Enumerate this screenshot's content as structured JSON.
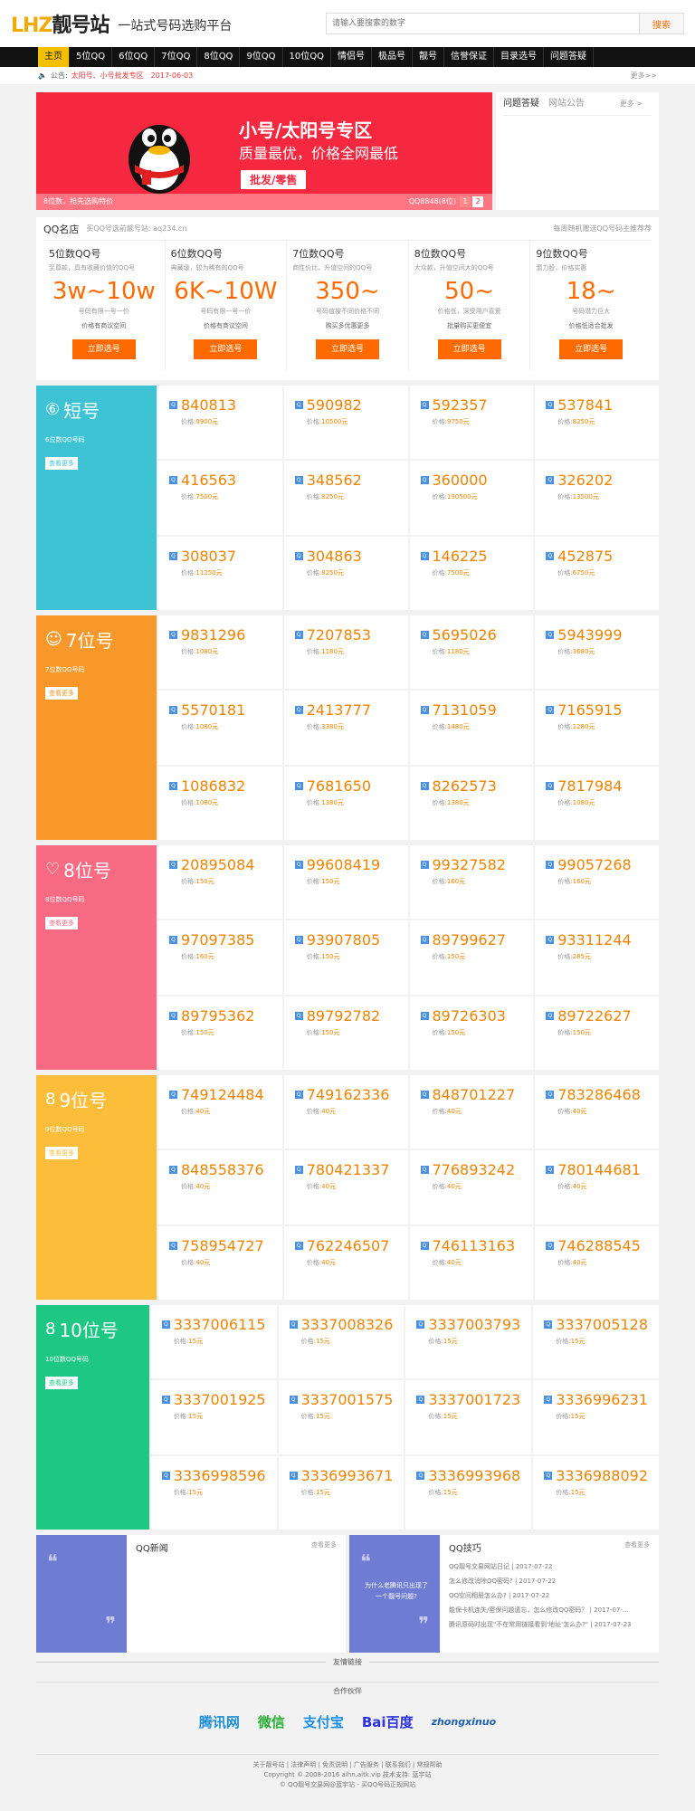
{
  "header": {
    "logo_lhz": "LHZ",
    "logo_cn": "靓号站",
    "slogan": "一站式号码选购平台",
    "search_placeholder": "请输入要搜索的数字",
    "search_button": "搜索"
  },
  "nav": [
    "主页",
    "5位QQ",
    "6位QQ",
    "7位QQ",
    "8位QQ",
    "9位QQ",
    "10位QQ",
    "情侣号",
    "极品号",
    "靓号",
    "信誉保证",
    "目录选号",
    "问题答疑"
  ],
  "notice": {
    "label": "公告:",
    "text": "太阳号、小号批发专区",
    "date": "2017-06-03",
    "more": "更多>>"
  },
  "banner": {
    "title": "小号/太阳号专区",
    "sub": "质量最优，价格全网最低",
    "button": "批发/零售",
    "strip": "8位数，抢先选购特价",
    "counter": "QQ8848(8位)",
    "dots": [
      "1",
      "2"
    ]
  },
  "sidebox": {
    "tab1": "问题答疑",
    "tab2": "网站公告",
    "more": "更多 >"
  },
  "qqshop": {
    "title": "QQ名店",
    "sub": "买QQ号选前靓号站: aq234.cn",
    "right": "每周随机赠送QQ号码主推荐荐"
  },
  "cats": [
    {
      "name": "5位数QQ号",
      "desc": "至尊款，具有收藏价值的QQ号",
      "range": "3w~10w",
      "d2": "号码有限一号一价",
      "d3": "价格有商议空间",
      "btn": "立即选号"
    },
    {
      "name": "6位数QQ号",
      "desc": "典藏级，较为稀有的QQ号",
      "range": "6K~10W",
      "d2": "号码有限一号一价",
      "d3": "价格有商议空间",
      "btn": "立即选号"
    },
    {
      "name": "7位数QQ号",
      "desc": "商性价比，升值空间的QQ号",
      "range": "350~",
      "d2": "号码值按不同价格不同",
      "d3": "购买多优惠更多",
      "btn": "立即选号"
    },
    {
      "name": "8位数QQ号",
      "desc": "大众款，升值空间大的QQ号",
      "range": "50~",
      "d2": "价格低，深受用户喜爱",
      "d3": "批量购买更便宜",
      "btn": "立即选号"
    },
    {
      "name": "9位数QQ号",
      "desc": "潜力股，价格实惠",
      "range": "18~",
      "d2": "号码潜力巨大",
      "d3": "价格低适合批发",
      "btn": "立即选号"
    }
  ],
  "sections": [
    {
      "title": "短号",
      "icon": "⑥",
      "color": "#3ec3d5",
      "desc": "6位数QQ号码",
      "more": "查看更多",
      "items": [
        {
          "num": "840813",
          "price": "9900元"
        },
        {
          "num": "590982",
          "price": "10500元"
        },
        {
          "num": "592357",
          "price": "9750元"
        },
        {
          "num": "537841",
          "price": "8250元"
        },
        {
          "num": "416563",
          "price": "7500元"
        },
        {
          "num": "348562",
          "price": "8250元"
        },
        {
          "num": "360000",
          "price": "190500元"
        },
        {
          "num": "326202",
          "price": "13500元"
        },
        {
          "num": "308037",
          "price": "11250元"
        },
        {
          "num": "304863",
          "price": "8250元"
        },
        {
          "num": "146225",
          "price": "7500元"
        },
        {
          "num": "452875",
          "price": "6750元"
        }
      ]
    },
    {
      "title": "7位号",
      "icon": "☺",
      "color": "#f9982a",
      "desc": "7位数QQ号码",
      "more": "查看更多",
      "items": [
        {
          "num": "9831296",
          "price": "1080元"
        },
        {
          "num": "7207853",
          "price": "1180元"
        },
        {
          "num": "5695026",
          "price": "1180元"
        },
        {
          "num": "5943999",
          "price": "3680元"
        },
        {
          "num": "5570181",
          "price": "1080元"
        },
        {
          "num": "2413777",
          "price": "3380元"
        },
        {
          "num": "7131059",
          "price": "1480元"
        },
        {
          "num": "7165915",
          "price": "1280元"
        },
        {
          "num": "1086832",
          "price": "1080元"
        },
        {
          "num": "7681650",
          "price": "1380元"
        },
        {
          "num": "8262573",
          "price": "1380元"
        },
        {
          "num": "7817984",
          "price": "1080元"
        }
      ]
    },
    {
      "title": "8位号",
      "icon": "♡",
      "color": "#f86b83",
      "desc": "8位数QQ号码",
      "more": "查看更多",
      "items": [
        {
          "num": "20895084",
          "price": "150元"
        },
        {
          "num": "99608419",
          "price": "150元"
        },
        {
          "num": "99327582",
          "price": "160元"
        },
        {
          "num": "99057268",
          "price": "160元"
        },
        {
          "num": "97097385",
          "price": "160元"
        },
        {
          "num": "93907805",
          "price": "150元"
        },
        {
          "num": "89799627",
          "price": "150元"
        },
        {
          "num": "93311244",
          "price": "285元"
        },
        {
          "num": "89795362",
          "price": "150元"
        },
        {
          "num": "89792782",
          "price": "150元"
        },
        {
          "num": "89726303",
          "price": "150元"
        },
        {
          "num": "89722627",
          "price": "150元"
        }
      ]
    },
    {
      "title": "9位号",
      "icon": "8",
      "color": "#fcbd3b",
      "desc": "9位数QQ号码",
      "more": "查看更多",
      "items": [
        {
          "num": "749124484",
          "price": "40元"
        },
        {
          "num": "749162336",
          "price": "40元"
        },
        {
          "num": "848701227",
          "price": "40元"
        },
        {
          "num": "783286468",
          "price": "40元"
        },
        {
          "num": "848558376",
          "price": "40元"
        },
        {
          "num": "780421337",
          "price": "40元"
        },
        {
          "num": "776893242",
          "price": "40元"
        },
        {
          "num": "780144681",
          "price": "40元"
        },
        {
          "num": "758954727",
          "price": "40元"
        },
        {
          "num": "762246507",
          "price": "40元"
        },
        {
          "num": "746113163",
          "price": "40元"
        },
        {
          "num": "746288545",
          "price": "40元"
        }
      ]
    },
    {
      "title": "10位号",
      "icon": "8",
      "color": "#1ec884",
      "desc": "10位数QQ号码",
      "more": "查看更多",
      "items": [
        {
          "num": "3337006115",
          "price": "15元"
        },
        {
          "num": "3337008326",
          "price": "15元"
        },
        {
          "num": "3337003793",
          "price": "15元"
        },
        {
          "num": "3337005128",
          "price": "15元"
        },
        {
          "num": "3337001925",
          "price": "15元"
        },
        {
          "num": "3337001575",
          "price": "15元"
        },
        {
          "num": "3337001723",
          "price": "15元"
        },
        {
          "num": "3336996231",
          "price": "15元"
        },
        {
          "num": "3336998596",
          "price": "15元"
        },
        {
          "num": "3336993671",
          "price": "15元"
        },
        {
          "num": "3336993968",
          "price": "15元"
        },
        {
          "num": "3336988092",
          "price": "15元"
        }
      ]
    }
  ],
  "price_label": "价格:",
  "news": {
    "title": "QQ新闻",
    "more": "查看更多"
  },
  "tips": {
    "title": "QQ技巧",
    "more": "查看更多",
    "deco": "为什么老腾讯只出现了一个靓号问题?",
    "items": [
      "QQ靓号交易网站日记 | 2017-07-22",
      "怎么修改消除QQ密码? | 2017-07-22",
      "QQ空间相册怎么办? | 2017-07-22",
      "能保卡机连失/密保问题遗忘，怎么修改QQ密码？ | 2017-07-...",
      "腾讯原码时出现\"不在常用链接看到'地址'怎么办?\" | 2017-07-23"
    ]
  },
  "friend_links": "友情链接",
  "partners_title": "合作伙伴",
  "partners": [
    "腾讯网",
    "微信",
    "支付宝",
    "Bai百度",
    "zhongxinuo"
  ],
  "footer": {
    "links": "关于靓号站 | 法律声明 | 免责说明 | 广告服务 | 联系我们 | 常规帮助",
    "copy": "Copyright © 2008-2016 aihn.aitk.vip 技术支持: 蓝宇站",
    "icp": "© QQ靓号交易网@蓝宇站 - 买QQ号码正规网站"
  }
}
